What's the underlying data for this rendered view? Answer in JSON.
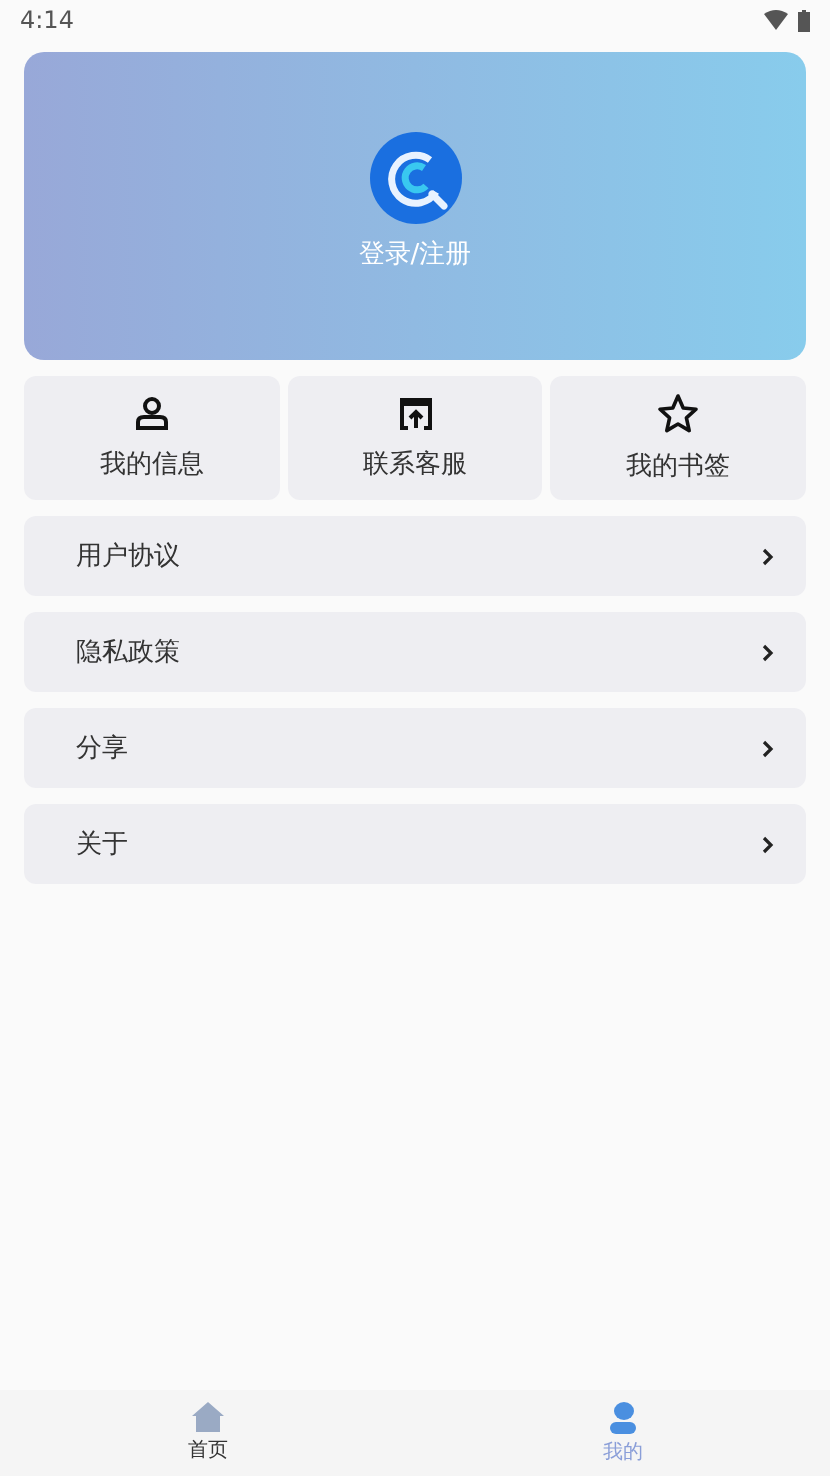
{
  "status_bar": {
    "time": "4:14"
  },
  "banner": {
    "login": "登录/注册"
  },
  "shortcuts": [
    {
      "label": "我的信息"
    },
    {
      "label": "联系客服"
    },
    {
      "label": "我的书签"
    }
  ],
  "menu": [
    {
      "label": "用户协议"
    },
    {
      "label": "隐私政策"
    },
    {
      "label": "分享"
    },
    {
      "label": "关于"
    }
  ],
  "tab_bar": [
    {
      "label": "首页",
      "selected": false
    },
    {
      "label": "我的",
      "selected": true
    }
  ]
}
